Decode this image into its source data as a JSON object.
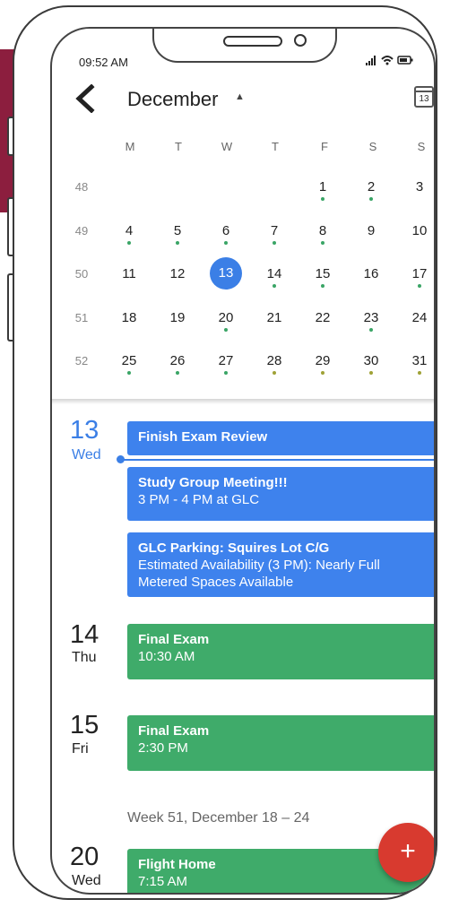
{
  "status": {
    "time": "09:52 AM"
  },
  "header": {
    "month": "December",
    "calendar_icon_label": "13"
  },
  "weekdays": [
    "M",
    "T",
    "W",
    "T",
    "F",
    "S",
    "S"
  ],
  "weeks": [
    {
      "num": "48",
      "days": [
        "",
        "",
        "",
        "",
        "1",
        "2",
        "3"
      ]
    },
    {
      "num": "49",
      "days": [
        "4",
        "5",
        "6",
        "7",
        "8",
        "9",
        "10"
      ]
    },
    {
      "num": "50",
      "days": [
        "11",
        "12",
        "13",
        "14",
        "15",
        "16",
        "17"
      ]
    },
    {
      "num": "51",
      "days": [
        "18",
        "19",
        "20",
        "21",
        "22",
        "23",
        "24"
      ]
    },
    {
      "num": "52",
      "days": [
        "25",
        "26",
        "27",
        "28",
        "29",
        "30",
        "31"
      ]
    }
  ],
  "agenda": {
    "day13": {
      "num": "13",
      "weekday": "Wed"
    },
    "day14": {
      "num": "14",
      "weekday": "Thu"
    },
    "day15": {
      "num": "15",
      "weekday": "Fri"
    },
    "day20": {
      "num": "20",
      "weekday": "Wed"
    },
    "events": [
      {
        "title": "Finish Exam Review",
        "line2": "",
        "line3": ""
      },
      {
        "title": "Study Group Meeting!!!",
        "line2": "3 PM - 4 PM at GLC",
        "line3": ""
      },
      {
        "title": "GLC Parking: Squires Lot C/G",
        "line2": "Estimated Availability (3 PM): Nearly Full",
        "line3": "Metered Spaces Available"
      },
      {
        "title": "Final Exam",
        "line2": "10:30 AM",
        "line3": ""
      },
      {
        "title": "Final Exam",
        "line2": "2:30 PM",
        "line3": ""
      },
      {
        "title": "Flight Home",
        "line2": "7:15 AM",
        "line3": ""
      }
    ],
    "week_label": "Week 51, December 18 – 24"
  },
  "fab": {
    "label": "+"
  },
  "colors": {
    "accent_blue": "#3b7fe6",
    "event_green": "#3fab6a",
    "fab_red": "#d83a2f"
  }
}
